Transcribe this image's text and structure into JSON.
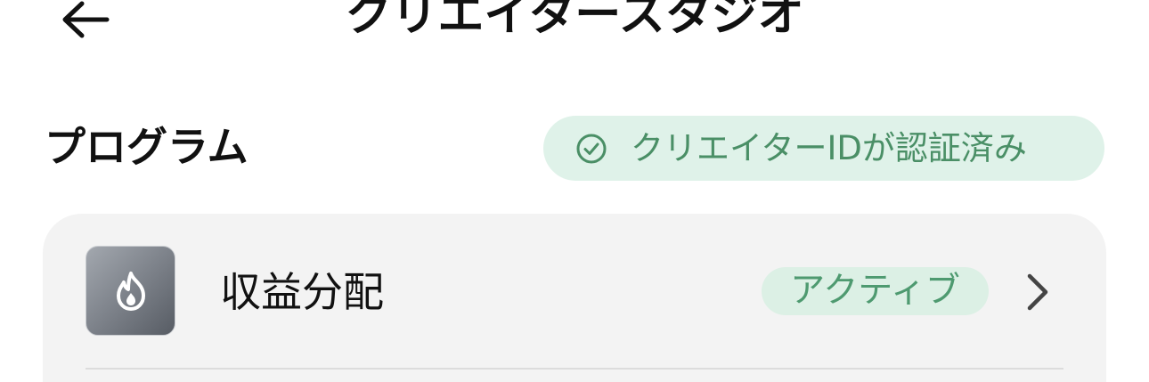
{
  "header": {
    "title": "クリエイタースタジオ",
    "back_icon": "arrow-left-icon"
  },
  "section": {
    "title": "プログラム",
    "verified_badge": {
      "label": "クリエイターIDが認証済み",
      "icon": "check-circle-icon"
    }
  },
  "programs": [
    {
      "name": "収益分配",
      "icon": "flame-icon",
      "status": "アクティブ",
      "chevron_icon": "chevron-right-icon"
    }
  ],
  "colors": {
    "badge_bg": "#dff2e9",
    "badge_text": "#4a8f66",
    "status_bg": "#dcf0e5",
    "status_text": "#4e9a70",
    "card_bg": "#f3f3f3",
    "icon_tile_from": "#a3a8af",
    "icon_tile_to": "#575c64"
  }
}
